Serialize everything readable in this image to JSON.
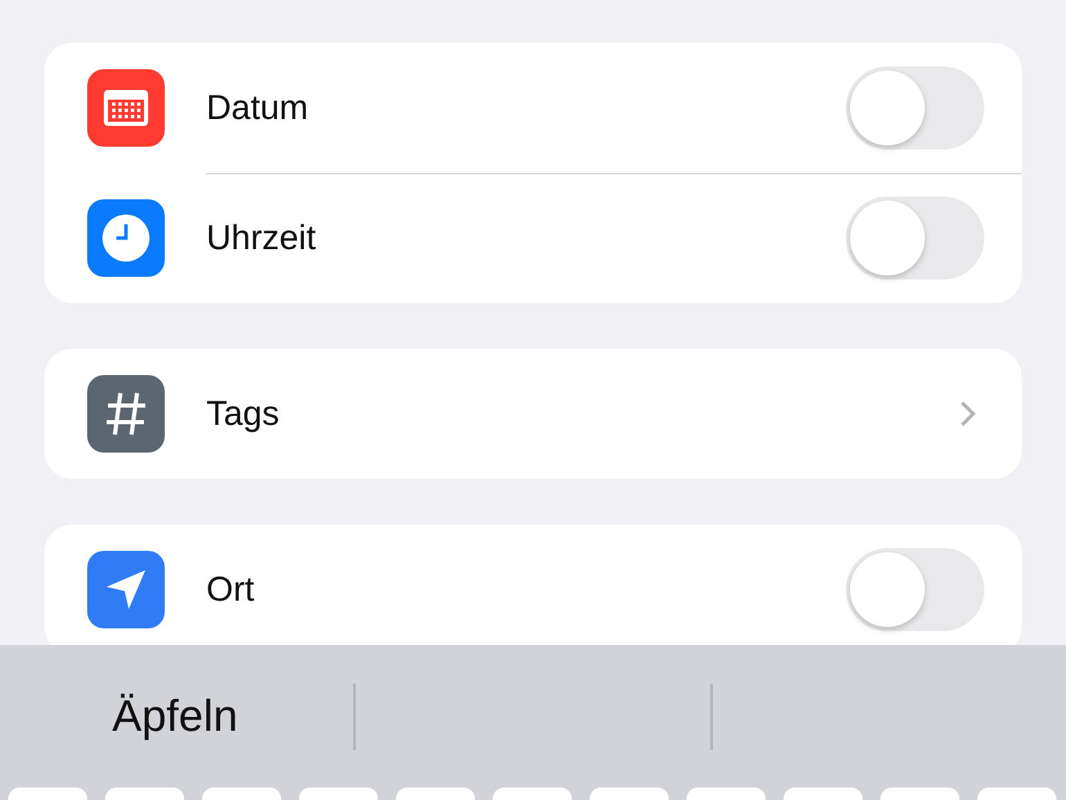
{
  "groups": [
    {
      "rows": [
        {
          "kind": "toggle",
          "label": "Datum",
          "on": false
        },
        {
          "kind": "toggle",
          "label": "Uhrzeit",
          "on": false
        }
      ]
    },
    {
      "rows": [
        {
          "kind": "link",
          "label": "Tags"
        }
      ]
    },
    {
      "rows": [
        {
          "kind": "toggle",
          "label": "Ort",
          "on": false
        }
      ]
    }
  ],
  "keyboard": {
    "suggestions": [
      "Äpfeln"
    ]
  }
}
